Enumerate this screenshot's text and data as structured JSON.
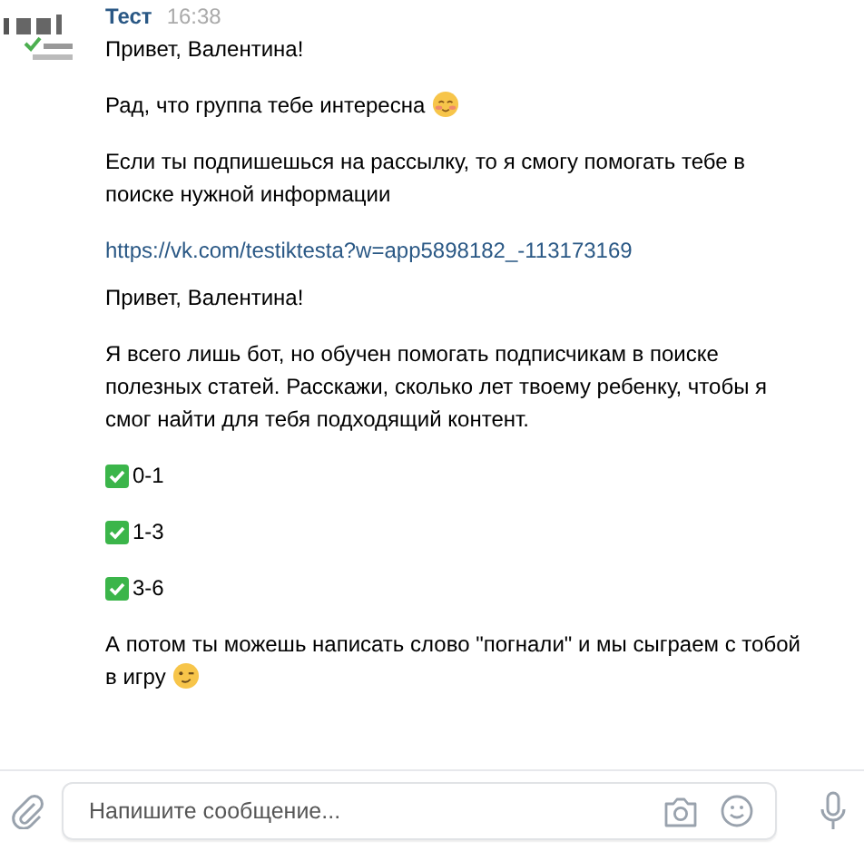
{
  "message": {
    "author": "Тест",
    "time": "16:38",
    "groups": [
      [
        {
          "kind": "text",
          "text": "Привет, Валентина!"
        },
        {
          "kind": "text",
          "text": "Рад, что группа тебе интересна",
          "emoji": {
            "kind": "blush"
          }
        },
        {
          "kind": "text",
          "text": "Если ты подпишешься на рассылку, то я смогу помогать тебе в поиске нужной информации"
        },
        {
          "kind": "link",
          "text": "https://vk.com/testiktesta?w=app5898182_-113173169"
        }
      ],
      [
        {
          "kind": "text",
          "text": "Привет, Валентина!"
        },
        {
          "kind": "text",
          "text": "Я всего лишь бот, но обучен помогать подписчикам в поиске полезных статей. Расскажи, сколько лет твоему ребенку, чтобы я смог найти для тебя подходящий контент."
        },
        {
          "kind": "check",
          "text": "0-1"
        },
        {
          "kind": "check",
          "text": "1-3"
        },
        {
          "kind": "check",
          "text": "3-6"
        },
        {
          "kind": "text",
          "text": "А потом ты можешь написать слово \"погнали\" и мы сыграем с тобой в игру",
          "emoji": {
            "kind": "wink"
          }
        }
      ]
    ]
  },
  "composer": {
    "placeholder": "Напишите сообщение..."
  }
}
